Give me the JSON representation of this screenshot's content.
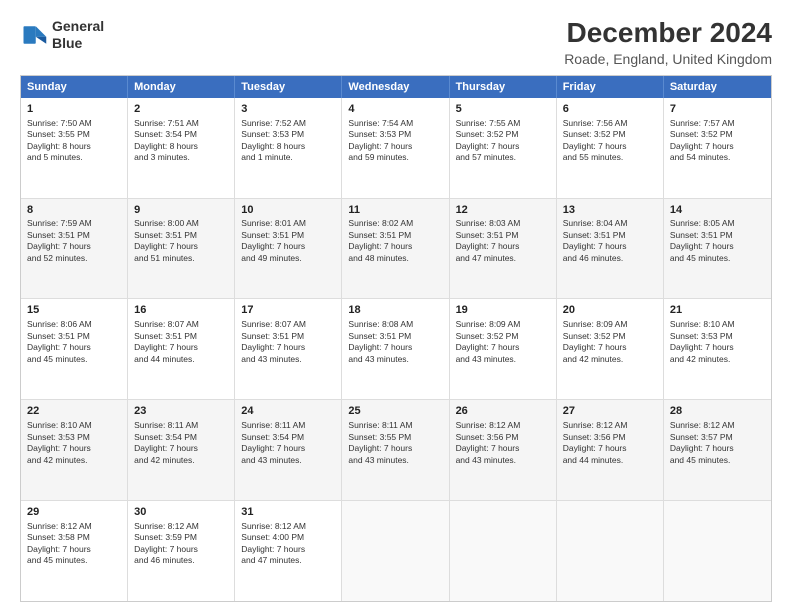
{
  "logo": {
    "line1": "General",
    "line2": "Blue"
  },
  "title": "December 2024",
  "subtitle": "Roade, England, United Kingdom",
  "header_days": [
    "Sunday",
    "Monday",
    "Tuesday",
    "Wednesday",
    "Thursday",
    "Friday",
    "Saturday"
  ],
  "weeks": [
    [
      {
        "day": "1",
        "lines": [
          "Sunrise: 7:50 AM",
          "Sunset: 3:55 PM",
          "Daylight: 8 hours",
          "and 5 minutes."
        ]
      },
      {
        "day": "2",
        "lines": [
          "Sunrise: 7:51 AM",
          "Sunset: 3:54 PM",
          "Daylight: 8 hours",
          "and 3 minutes."
        ]
      },
      {
        "day": "3",
        "lines": [
          "Sunrise: 7:52 AM",
          "Sunset: 3:53 PM",
          "Daylight: 8 hours",
          "and 1 minute."
        ]
      },
      {
        "day": "4",
        "lines": [
          "Sunrise: 7:54 AM",
          "Sunset: 3:53 PM",
          "Daylight: 7 hours",
          "and 59 minutes."
        ]
      },
      {
        "day": "5",
        "lines": [
          "Sunrise: 7:55 AM",
          "Sunset: 3:52 PM",
          "Daylight: 7 hours",
          "and 57 minutes."
        ]
      },
      {
        "day": "6",
        "lines": [
          "Sunrise: 7:56 AM",
          "Sunset: 3:52 PM",
          "Daylight: 7 hours",
          "and 55 minutes."
        ]
      },
      {
        "day": "7",
        "lines": [
          "Sunrise: 7:57 AM",
          "Sunset: 3:52 PM",
          "Daylight: 7 hours",
          "and 54 minutes."
        ]
      }
    ],
    [
      {
        "day": "8",
        "lines": [
          "Sunrise: 7:59 AM",
          "Sunset: 3:51 PM",
          "Daylight: 7 hours",
          "and 52 minutes."
        ]
      },
      {
        "day": "9",
        "lines": [
          "Sunrise: 8:00 AM",
          "Sunset: 3:51 PM",
          "Daylight: 7 hours",
          "and 51 minutes."
        ]
      },
      {
        "day": "10",
        "lines": [
          "Sunrise: 8:01 AM",
          "Sunset: 3:51 PM",
          "Daylight: 7 hours",
          "and 49 minutes."
        ]
      },
      {
        "day": "11",
        "lines": [
          "Sunrise: 8:02 AM",
          "Sunset: 3:51 PM",
          "Daylight: 7 hours",
          "and 48 minutes."
        ]
      },
      {
        "day": "12",
        "lines": [
          "Sunrise: 8:03 AM",
          "Sunset: 3:51 PM",
          "Daylight: 7 hours",
          "and 47 minutes."
        ]
      },
      {
        "day": "13",
        "lines": [
          "Sunrise: 8:04 AM",
          "Sunset: 3:51 PM",
          "Daylight: 7 hours",
          "and 46 minutes."
        ]
      },
      {
        "day": "14",
        "lines": [
          "Sunrise: 8:05 AM",
          "Sunset: 3:51 PM",
          "Daylight: 7 hours",
          "and 45 minutes."
        ]
      }
    ],
    [
      {
        "day": "15",
        "lines": [
          "Sunrise: 8:06 AM",
          "Sunset: 3:51 PM",
          "Daylight: 7 hours",
          "and 45 minutes."
        ]
      },
      {
        "day": "16",
        "lines": [
          "Sunrise: 8:07 AM",
          "Sunset: 3:51 PM",
          "Daylight: 7 hours",
          "and 44 minutes."
        ]
      },
      {
        "day": "17",
        "lines": [
          "Sunrise: 8:07 AM",
          "Sunset: 3:51 PM",
          "Daylight: 7 hours",
          "and 43 minutes."
        ]
      },
      {
        "day": "18",
        "lines": [
          "Sunrise: 8:08 AM",
          "Sunset: 3:51 PM",
          "Daylight: 7 hours",
          "and 43 minutes."
        ]
      },
      {
        "day": "19",
        "lines": [
          "Sunrise: 8:09 AM",
          "Sunset: 3:52 PM",
          "Daylight: 7 hours",
          "and 43 minutes."
        ]
      },
      {
        "day": "20",
        "lines": [
          "Sunrise: 8:09 AM",
          "Sunset: 3:52 PM",
          "Daylight: 7 hours",
          "and 42 minutes."
        ]
      },
      {
        "day": "21",
        "lines": [
          "Sunrise: 8:10 AM",
          "Sunset: 3:53 PM",
          "Daylight: 7 hours",
          "and 42 minutes."
        ]
      }
    ],
    [
      {
        "day": "22",
        "lines": [
          "Sunrise: 8:10 AM",
          "Sunset: 3:53 PM",
          "Daylight: 7 hours",
          "and 42 minutes."
        ]
      },
      {
        "day": "23",
        "lines": [
          "Sunrise: 8:11 AM",
          "Sunset: 3:54 PM",
          "Daylight: 7 hours",
          "and 42 minutes."
        ]
      },
      {
        "day": "24",
        "lines": [
          "Sunrise: 8:11 AM",
          "Sunset: 3:54 PM",
          "Daylight: 7 hours",
          "and 43 minutes."
        ]
      },
      {
        "day": "25",
        "lines": [
          "Sunrise: 8:11 AM",
          "Sunset: 3:55 PM",
          "Daylight: 7 hours",
          "and 43 minutes."
        ]
      },
      {
        "day": "26",
        "lines": [
          "Sunrise: 8:12 AM",
          "Sunset: 3:56 PM",
          "Daylight: 7 hours",
          "and 43 minutes."
        ]
      },
      {
        "day": "27",
        "lines": [
          "Sunrise: 8:12 AM",
          "Sunset: 3:56 PM",
          "Daylight: 7 hours",
          "and 44 minutes."
        ]
      },
      {
        "day": "28",
        "lines": [
          "Sunrise: 8:12 AM",
          "Sunset: 3:57 PM",
          "Daylight: 7 hours",
          "and 45 minutes."
        ]
      }
    ],
    [
      {
        "day": "29",
        "lines": [
          "Sunrise: 8:12 AM",
          "Sunset: 3:58 PM",
          "Daylight: 7 hours",
          "and 45 minutes."
        ]
      },
      {
        "day": "30",
        "lines": [
          "Sunrise: 8:12 AM",
          "Sunset: 3:59 PM",
          "Daylight: 7 hours",
          "and 46 minutes."
        ]
      },
      {
        "day": "31",
        "lines": [
          "Sunrise: 8:12 AM",
          "Sunset: 4:00 PM",
          "Daylight: 7 hours",
          "and 47 minutes."
        ]
      },
      null,
      null,
      null,
      null
    ]
  ]
}
